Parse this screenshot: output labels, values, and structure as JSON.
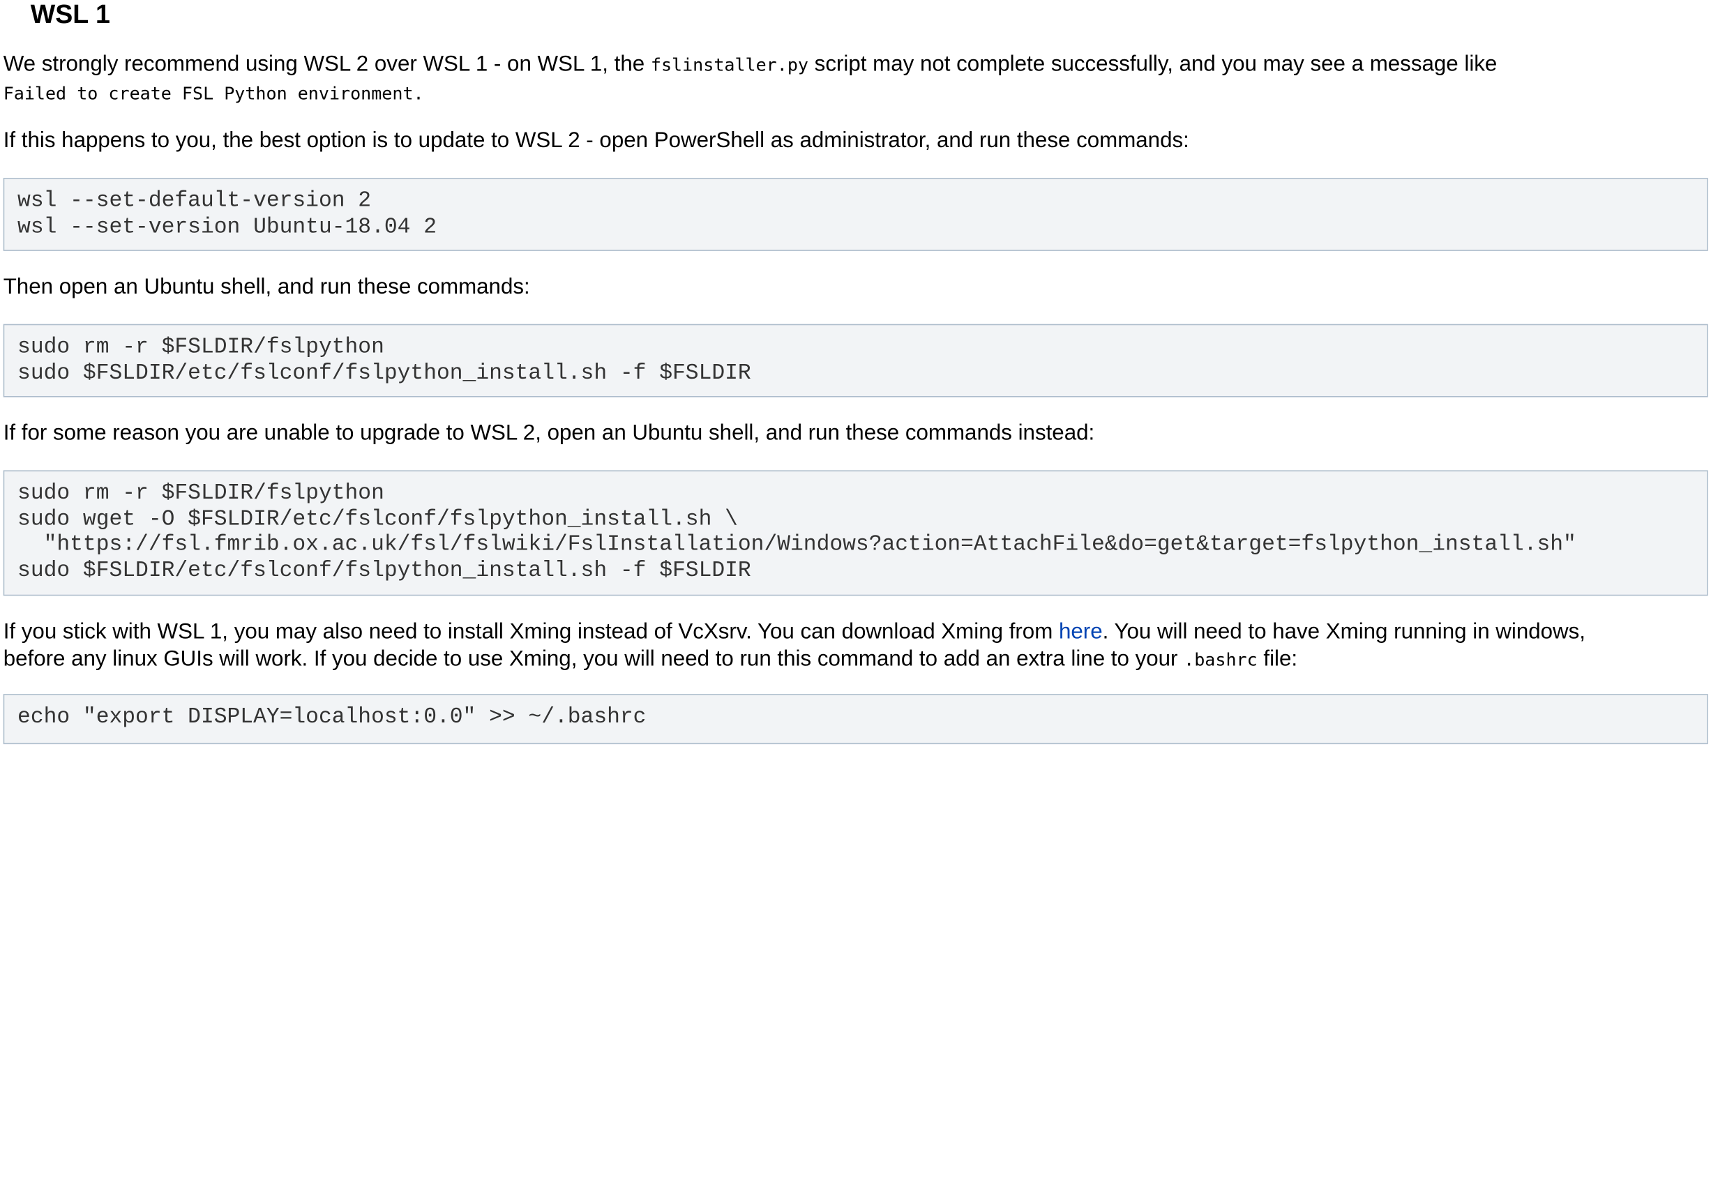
{
  "heading": "WSL 1",
  "intro": {
    "text_before_code": "We strongly recommend using WSL 2 over WSL 1 - on WSL 1, the ",
    "code": "fslinstaller.py",
    "text_after_code": " script may not complete successfully, and you may see a message like",
    "error_message": "Failed to create FSL Python environment."
  },
  "para_update": "If this happens to you, the best option is to update to WSL 2 - open PowerShell as administrator, and run these commands:",
  "code_block_1": [
    "wsl --set-default-version 2",
    "wsl --set-version Ubuntu-18.04 2"
  ],
  "para_ubuntu": "Then open an Ubuntu shell, and run these commands:",
  "code_block_2": [
    "sudo rm -r $FSLDIR/fslpython",
    "sudo $FSLDIR/etc/fslconf/fslpython_install.sh -f $FSLDIR"
  ],
  "para_unable": "If for some reason you are unable to upgrade to WSL 2, open an Ubuntu shell, and run these commands instead:",
  "code_block_3": [
    "sudo rm -r $FSLDIR/fslpython",
    "sudo wget -O $FSLDIR/etc/fslconf/fslpython_install.sh \\",
    "  \"https://fsl.fmrib.ox.ac.uk/fsl/fslwiki/FslInstallation/Windows?action=AttachFile&do=get&target=fslpython_install.sh\"",
    "sudo $FSLDIR/etc/fslconf/fslpython_install.sh -f $FSLDIR"
  ],
  "para_xming": {
    "line1_before_link": "If you stick with WSL 1, you may also need to install Xming instead of VcXsrv. You can download Xming from ",
    "link_text": "here",
    "line1_after_link": ". You will need to have Xming running in windows,",
    "line2_before_code": "before any linux GUIs will work. If you decide to use Xming, you will need to run this command to add an extra line to your ",
    "code": ".bashrc",
    "line2_after_code": " file:"
  },
  "code_block_4": [
    "echo \"export DISPLAY=localhost:0.0\" >> ~/.bashrc"
  ],
  "colors": {
    "link": "#0044b3",
    "code_bg": "#f2f4f6",
    "code_border": "#aebdcc",
    "code_text": "#333333"
  }
}
